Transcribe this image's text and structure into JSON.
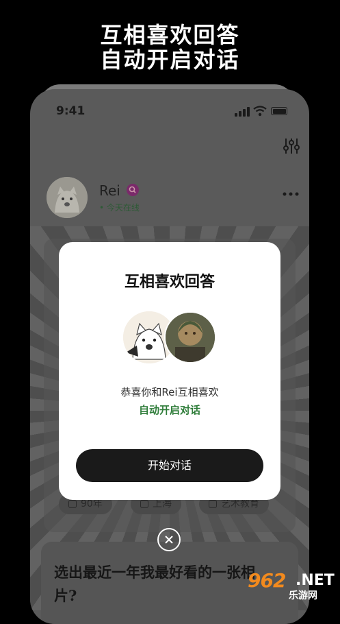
{
  "banner": {
    "line1": "互相喜欢回答",
    "line2": "自动开启对话"
  },
  "status_bar": {
    "time": "9:41"
  },
  "profile": {
    "name": "Rei",
    "online_status": "• 今天在线"
  },
  "tags": [
    {
      "label": "90年",
      "icon": "sprout-icon"
    },
    {
      "label": "上海",
      "icon": "location-icon"
    },
    {
      "label": "艺术教育",
      "icon": "briefcase-icon"
    }
  ],
  "modal": {
    "title": "互相喜欢回答",
    "message": "恭喜你和Rei互相喜欢",
    "subtitle": "自动开启对话",
    "button_label": "开始对话"
  },
  "question_card": {
    "text": "选出最近一年我最好看的一张相片?"
  },
  "watermark": {
    "number": "962",
    "domain": ".NET",
    "site": "乐游网"
  },
  "colors": {
    "accent_green": "#2f7d3a",
    "button_dark": "#1a1a1a",
    "verified_badge": "#7a2a6a",
    "watermark_orange": "#f28a1e"
  }
}
